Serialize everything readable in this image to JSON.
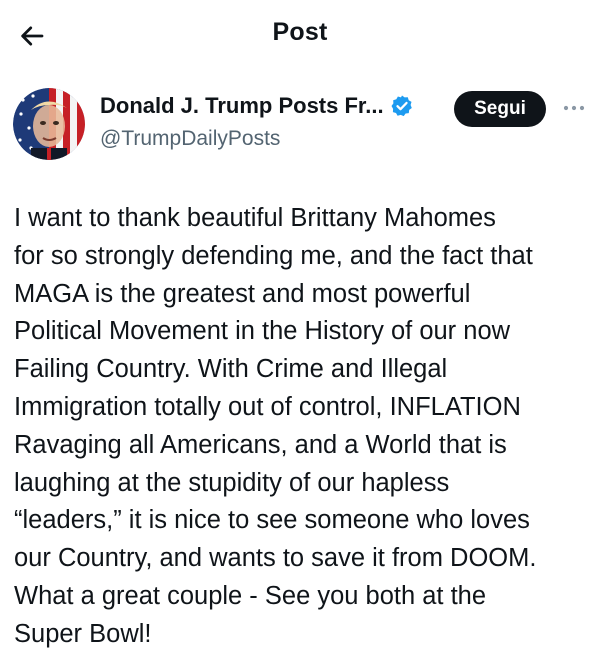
{
  "header": {
    "title": "Post",
    "back_icon": "arrow-left-icon"
  },
  "author": {
    "name": "Donald J. Trump Posts Fr...",
    "handle": "@TrumpDailyPosts",
    "verified_icon": "verified-badge-icon",
    "follow_label": "Segui",
    "more_icon": "more-options-icon",
    "avatar_icon": "profile-avatar"
  },
  "post": {
    "text": "I want to thank beautiful Brittany Mahomes\nfor so strongly defending me, and the fact that\nMAGA is the greatest and most powerful\nPolitical Movement in the History of our now\nFailing Country. With Crime and Illegal\nImmigration totally out of control, INFLATION\nRavaging all Americans, and a World that is\nlaughing at the stupidity of our hapless\n“leaders,” it is nice to see someone who loves\nour Country, and wants to save it from DOOM.\nWhat a great couple - See you both at the\nSuper Bowl!"
  },
  "colors": {
    "text": "#0f1419",
    "secondary_text": "#536471",
    "verified_blue": "#1d9bf0",
    "button_bg": "#0f1419",
    "button_text": "#ffffff"
  }
}
